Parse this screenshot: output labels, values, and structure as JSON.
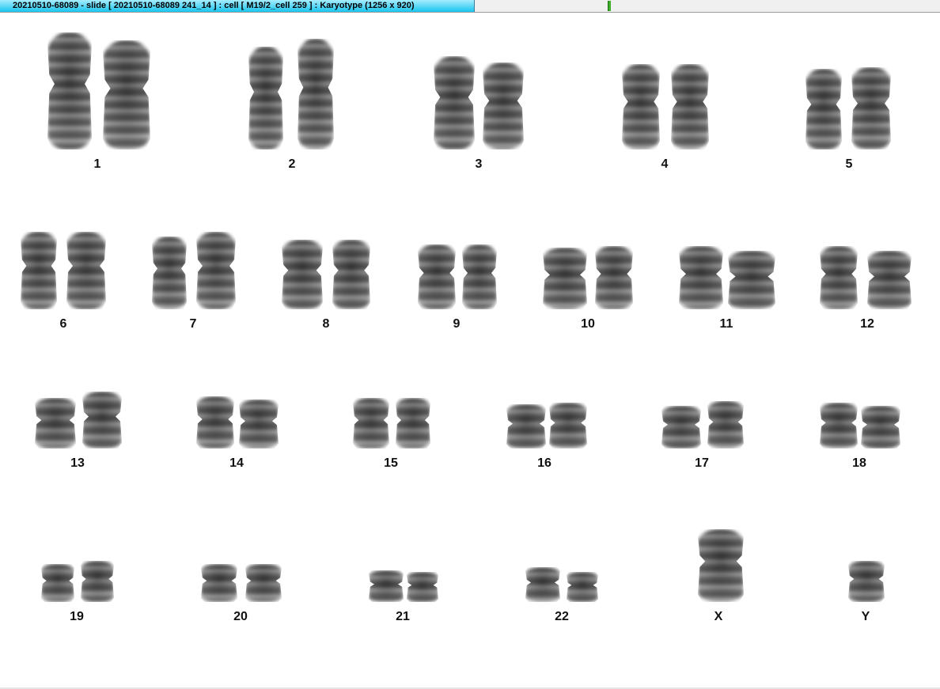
{
  "window": {
    "title": "20210510-68089 - slide [ 20210510-68089 241_14 ] : cell [ M19/2_cell 259 ] : Karyotype  (1256 x 920)"
  },
  "karyotype": {
    "pairs": [
      {
        "id": "1"
      },
      {
        "id": "2"
      },
      {
        "id": "3"
      },
      {
        "id": "4"
      },
      {
        "id": "5"
      },
      {
        "id": "6"
      },
      {
        "id": "7"
      },
      {
        "id": "8"
      },
      {
        "id": "9"
      },
      {
        "id": "10"
      },
      {
        "id": "11"
      },
      {
        "id": "12"
      },
      {
        "id": "13"
      },
      {
        "id": "14"
      },
      {
        "id": "15"
      },
      {
        "id": "16"
      },
      {
        "id": "17"
      },
      {
        "id": "18"
      },
      {
        "id": "19"
      },
      {
        "id": "20"
      },
      {
        "id": "21"
      },
      {
        "id": "22"
      },
      {
        "id": "X"
      },
      {
        "id": "Y"
      }
    ]
  },
  "colors": {
    "title_gradient_top": "#a6ecff",
    "title_gradient_bottom": "#19c5ee",
    "chromosome_dark": "#3a3a3a",
    "chromosome_light": "#9a9a9a",
    "background": "#ffffff"
  }
}
